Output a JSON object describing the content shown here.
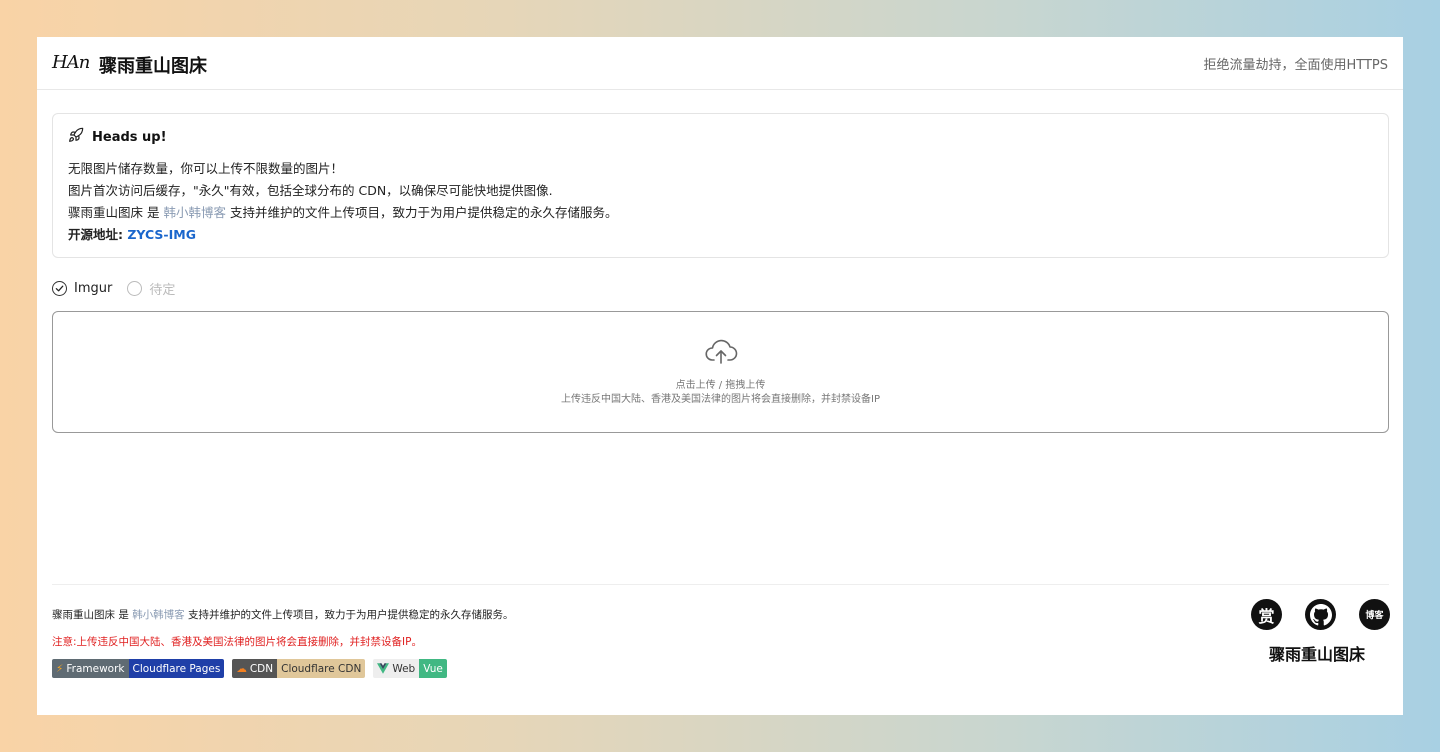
{
  "header": {
    "logo": "HAn",
    "title": "骤雨重山图床",
    "slogan": "拒绝流量劫持，全面使用HTTPS"
  },
  "notice": {
    "icon": "rocket-icon",
    "title": "Heads up!",
    "line1": "无限图片储存数量，你可以上传不限数量的图片！",
    "line2": "图片首次访问后缓存，\"永久\"有效，包括全球分布的 CDN，以确保尽可能快地提供图像.",
    "line3_prefix": "骤雨重山图床 是 ",
    "line3_link": "韩小韩博客",
    "line3_suffix": " 支持并维护的文件上传项目，致力于为用户提供稳定的永久存储服务。",
    "line4_prefix": "开源地址: ",
    "line4_link": "ZYCS-IMG"
  },
  "radios": [
    {
      "label": "Imgur",
      "selected": true
    },
    {
      "label": "待定",
      "selected": false
    }
  ],
  "dropzone": {
    "icon": "cloud-upload-icon",
    "line1": "点击上传 / 拖拽上传",
    "line2": "上传违反中国大陆、香港及美国法律的图片将会直接删除，并封禁设备IP"
  },
  "footer": {
    "text_prefix": "骤雨重山图床 是 ",
    "text_link": "韩小韩博客",
    "text_suffix": " 支持并维护的文件上传项目，致力于为用户提供稳定的永久存储服务。",
    "warning": "注意:上传违反中国大陆、香港及美国法律的图片将会直接删除，并封禁设备IP。",
    "badges": [
      {
        "left": "Framework",
        "right": "Cloudflare Pages",
        "icon": "lightning-icon"
      },
      {
        "left": "CDN",
        "right": "Cloudflare CDN",
        "icon": "cloudflare-icon"
      },
      {
        "left": "Web",
        "right": "Vue",
        "icon": "vue-icon"
      }
    ],
    "socials": [
      {
        "label": "赏",
        "icon": "reward-icon"
      },
      {
        "label": "",
        "icon": "github-icon"
      },
      {
        "label": "博客",
        "icon": "blog-icon"
      }
    ],
    "brand": "骤雨重山图床"
  }
}
